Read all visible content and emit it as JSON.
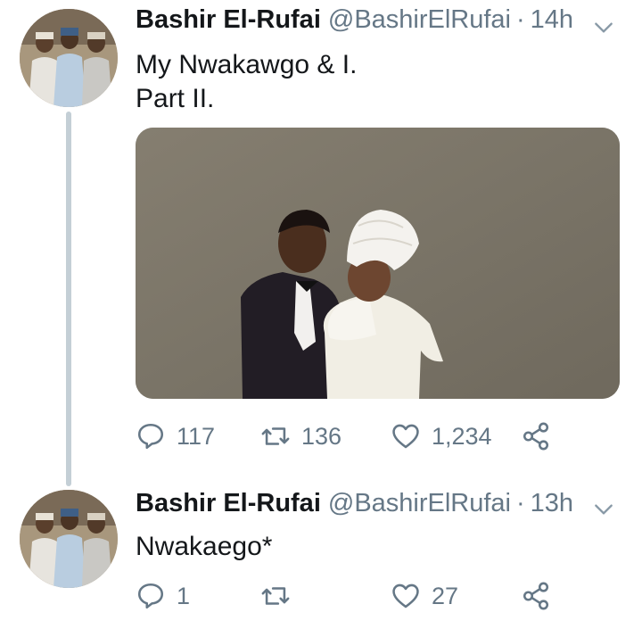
{
  "tweets": [
    {
      "name": "Bashir El-Rufai",
      "handle": "@BashirElRufai",
      "separator": "·",
      "time": "14h",
      "text_line1": "My Nwakawgo & I.",
      "text_line2": "Part II.",
      "replies": "117",
      "retweets": "136",
      "likes": "1,234"
    },
    {
      "name": "Bashir El-Rufai",
      "handle": "@BashirElRufai",
      "separator": "·",
      "time": "13h",
      "text_line1": "Nwakaego*",
      "replies": "1",
      "retweets": "",
      "likes": "27"
    }
  ],
  "icons": {
    "reply": "reply-bubble-icon",
    "retweet": "retweet-icon",
    "like": "heart-icon",
    "share": "share-icon",
    "menu": "chevron-down-icon"
  },
  "colors": {
    "text": "#14171a",
    "secondary": "#657786",
    "thread_line": "#c4cfd6"
  }
}
